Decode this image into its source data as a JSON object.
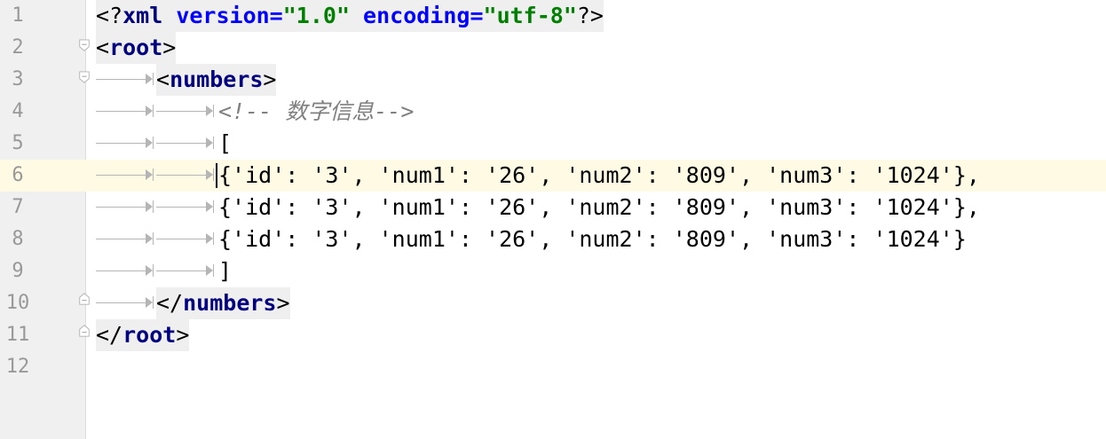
{
  "editor": {
    "current_line": 6,
    "lines": [
      {
        "no": "1"
      },
      {
        "no": "2"
      },
      {
        "no": "3"
      },
      {
        "no": "4"
      },
      {
        "no": "5"
      },
      {
        "no": "6"
      },
      {
        "no": "7"
      },
      {
        "no": "8"
      },
      {
        "no": "9"
      },
      {
        "no": "10"
      },
      {
        "no": "11"
      },
      {
        "no": "12"
      }
    ],
    "code": {
      "l1_open": "<?",
      "l1_xml": "xml",
      "l1_version_attr": " version=",
      "l1_version_val": "\"1.0\"",
      "l1_encoding_attr": " encoding=",
      "l1_encoding_val": "\"utf-8\"",
      "l1_close": "?>",
      "l2_lt": "<",
      "l2_tag": "root",
      "l2_gt": ">",
      "l3_lt": "<",
      "l3_tag": "numbers",
      "l3_gt": ">",
      "l4_comment": "<!-- 数字信息-->",
      "l5_text": "[",
      "l6_text": "{'id': '3', 'num1': '26', 'num2': '809', 'num3': '1024'},",
      "l7_text": "{'id': '3', 'num1': '26', 'num2': '809', 'num3': '1024'},",
      "l8_text": "{'id': '3', 'num1': '26', 'num2': '809', 'num3': '1024'}",
      "l9_text": "]",
      "l10_lt": "</",
      "l10_tag": "numbers",
      "l10_gt": ">",
      "l11_lt": "</",
      "l11_tag": "root",
      "l11_gt": ">"
    },
    "colors": {
      "tag": "#000080",
      "attribute": "#0000ff",
      "string": "#008000",
      "comment": "#808080",
      "current_line": "#fffae3",
      "gutter": "#f0f0f0"
    }
  }
}
